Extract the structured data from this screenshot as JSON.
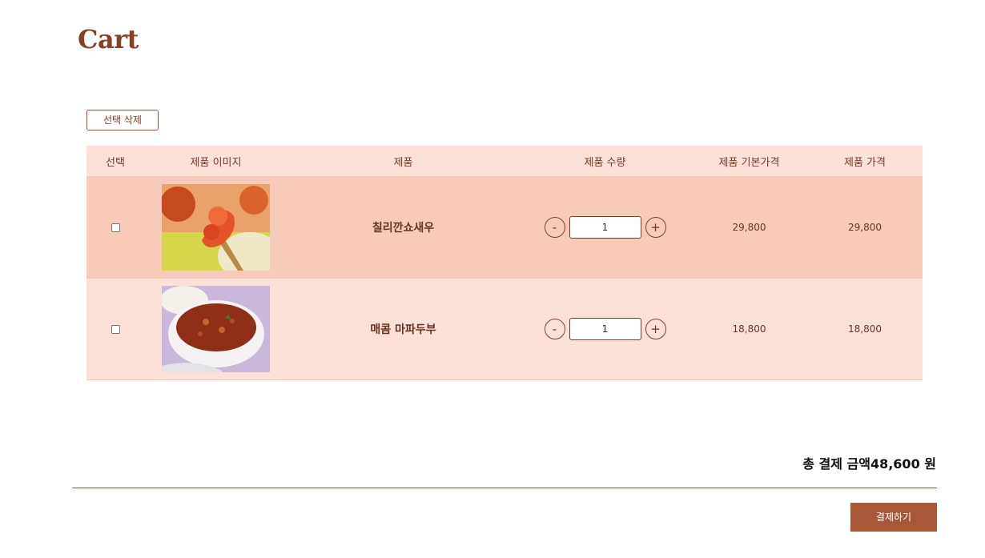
{
  "page": {
    "title": "Cart",
    "delete_selected_label": "선택 삭제"
  },
  "table": {
    "headers": {
      "select": "선택",
      "image": "제품 이미지",
      "product": "제품",
      "quantity": "제품 수량",
      "base_price": "제품 기본가격",
      "price": "제품 가격"
    },
    "rows": [
      {
        "checked": false,
        "image_icon": "chili-shrimp-photo",
        "name": "칠리깐쇼새우",
        "minus": "-",
        "quantity": "1",
        "plus": "+",
        "base_price": "29,800",
        "price": "29,800"
      },
      {
        "checked": false,
        "image_icon": "mapo-tofu-photo",
        "name": "매콤 마파두부",
        "minus": "-",
        "quantity": "1",
        "plus": "+",
        "base_price": "18,800",
        "price": "18,800"
      }
    ]
  },
  "summary": {
    "total_text": "총 결제 금액48,600 원"
  },
  "checkout_label": "결제하기",
  "colors": {
    "accent": "#a95837",
    "header_bg": "#fbe1d7",
    "row_highlight": "#f7cab9",
    "title": "#8b3f22"
  }
}
